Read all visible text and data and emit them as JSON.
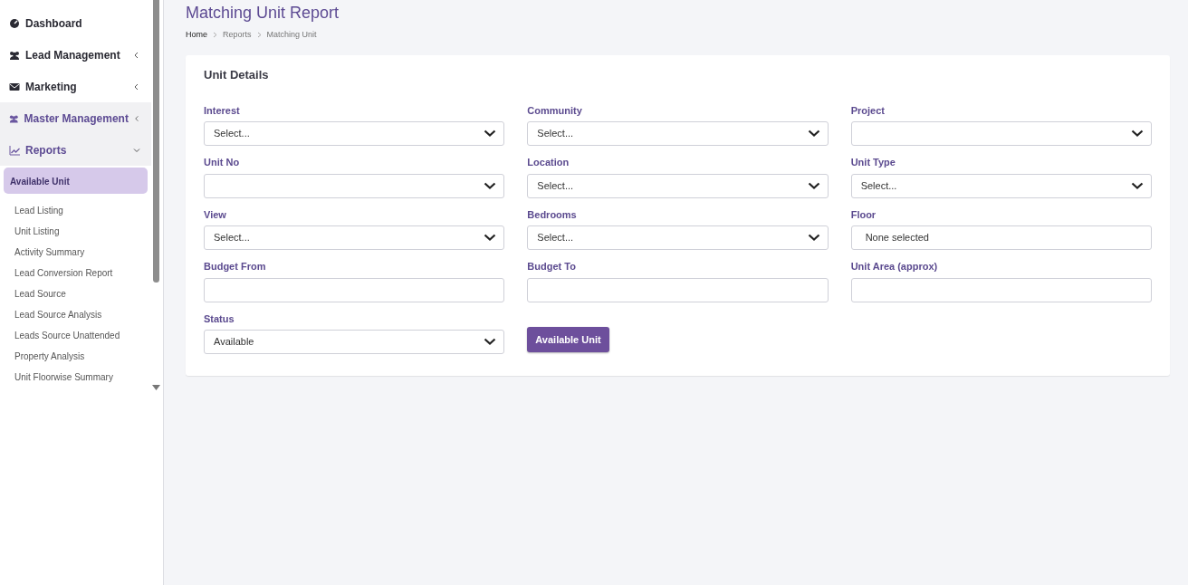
{
  "sidebar": {
    "items": [
      {
        "label": "Dashboard",
        "active": false
      },
      {
        "label": "Lead Management",
        "active": false,
        "expanded": false
      },
      {
        "label": "Marketing",
        "active": false,
        "expanded": false
      },
      {
        "label": "Master Management",
        "active": true,
        "expanded": false
      },
      {
        "label": "Reports",
        "active": true,
        "expanded": true,
        "children": [
          {
            "label": "Available Unit",
            "selected": true
          },
          {
            "label": "Lead Listing",
            "selected": false
          },
          {
            "label": "Unit Listing",
            "selected": false
          },
          {
            "label": "Activity Summary",
            "selected": false
          },
          {
            "label": "Lead Conversion Report",
            "selected": false
          },
          {
            "label": "Lead Source",
            "selected": false
          },
          {
            "label": "Lead Source Analysis",
            "selected": false
          },
          {
            "label": "Leads Source Unattended",
            "selected": false
          },
          {
            "label": "Property Analysis",
            "selected": false
          },
          {
            "label": "Unit Floorwise Summary",
            "selected": false
          }
        ]
      }
    ]
  },
  "page": {
    "title": "Matching Unit Report",
    "breadcrumb": [
      {
        "label": "Home",
        "current": false
      },
      {
        "label": "Reports",
        "current": true
      },
      {
        "label": "Matching Unit",
        "current": true
      }
    ]
  },
  "card": {
    "title": "Unit Details",
    "fields": [
      {
        "label": "Interest",
        "kind": "select",
        "value": "Select..."
      },
      {
        "label": "Community",
        "kind": "select",
        "value": "Select..."
      },
      {
        "label": "Project",
        "kind": "select"
      },
      {
        "label": "Unit No",
        "kind": "select"
      },
      {
        "label": "Location",
        "kind": "select",
        "value": "Select..."
      },
      {
        "label": "Unit Type",
        "kind": "select",
        "value": "Select..."
      },
      {
        "label": "View",
        "kind": "select",
        "value": "Select..."
      },
      {
        "label": "Bedrooms",
        "kind": "select",
        "value": "Select..."
      },
      {
        "label": "Floor",
        "kind": "multiselect",
        "value": "None selected"
      },
      {
        "label": "Budget From",
        "kind": "text"
      },
      {
        "label": "Budget To",
        "kind": "text"
      },
      {
        "label": "Unit Area (approx)",
        "kind": "text"
      },
      {
        "label": "Status",
        "kind": "select",
        "value": "Available"
      },
      {
        "kind": "button",
        "label": "Available Unit"
      }
    ]
  }
}
